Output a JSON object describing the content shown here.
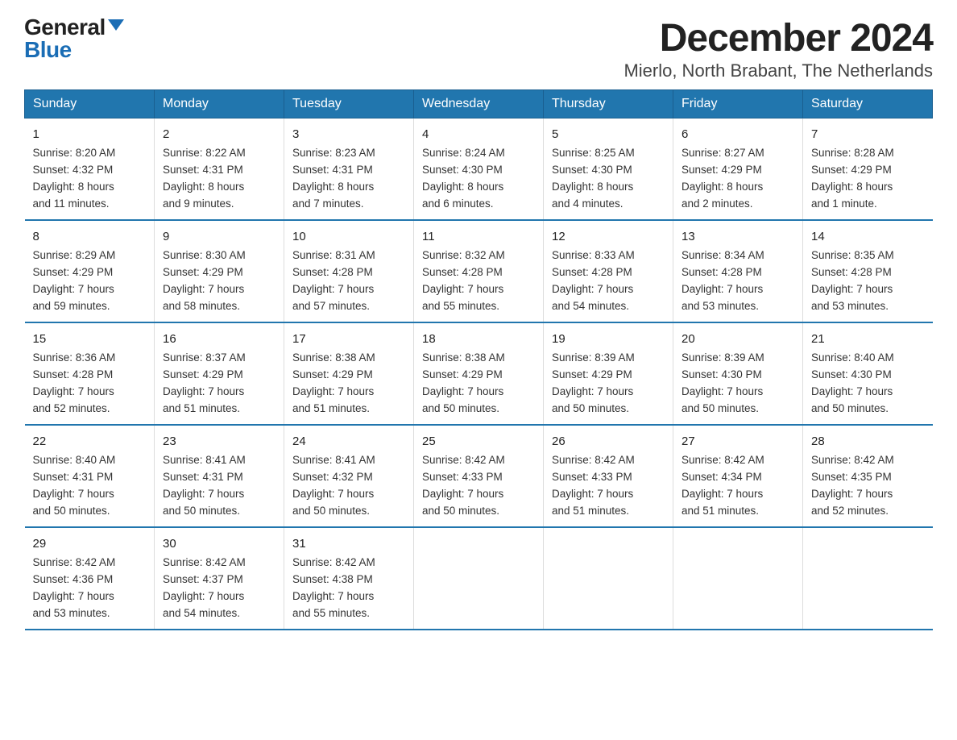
{
  "logo": {
    "general": "General",
    "blue": "Blue"
  },
  "title": "December 2024",
  "subtitle": "Mierlo, North Brabant, The Netherlands",
  "days_of_week": [
    "Sunday",
    "Monday",
    "Tuesday",
    "Wednesday",
    "Thursday",
    "Friday",
    "Saturday"
  ],
  "weeks": [
    [
      {
        "num": "1",
        "info": "Sunrise: 8:20 AM\nSunset: 4:32 PM\nDaylight: 8 hours\nand 11 minutes."
      },
      {
        "num": "2",
        "info": "Sunrise: 8:22 AM\nSunset: 4:31 PM\nDaylight: 8 hours\nand 9 minutes."
      },
      {
        "num": "3",
        "info": "Sunrise: 8:23 AM\nSunset: 4:31 PM\nDaylight: 8 hours\nand 7 minutes."
      },
      {
        "num": "4",
        "info": "Sunrise: 8:24 AM\nSunset: 4:30 PM\nDaylight: 8 hours\nand 6 minutes."
      },
      {
        "num": "5",
        "info": "Sunrise: 8:25 AM\nSunset: 4:30 PM\nDaylight: 8 hours\nand 4 minutes."
      },
      {
        "num": "6",
        "info": "Sunrise: 8:27 AM\nSunset: 4:29 PM\nDaylight: 8 hours\nand 2 minutes."
      },
      {
        "num": "7",
        "info": "Sunrise: 8:28 AM\nSunset: 4:29 PM\nDaylight: 8 hours\nand 1 minute."
      }
    ],
    [
      {
        "num": "8",
        "info": "Sunrise: 8:29 AM\nSunset: 4:29 PM\nDaylight: 7 hours\nand 59 minutes."
      },
      {
        "num": "9",
        "info": "Sunrise: 8:30 AM\nSunset: 4:29 PM\nDaylight: 7 hours\nand 58 minutes."
      },
      {
        "num": "10",
        "info": "Sunrise: 8:31 AM\nSunset: 4:28 PM\nDaylight: 7 hours\nand 57 minutes."
      },
      {
        "num": "11",
        "info": "Sunrise: 8:32 AM\nSunset: 4:28 PM\nDaylight: 7 hours\nand 55 minutes."
      },
      {
        "num": "12",
        "info": "Sunrise: 8:33 AM\nSunset: 4:28 PM\nDaylight: 7 hours\nand 54 minutes."
      },
      {
        "num": "13",
        "info": "Sunrise: 8:34 AM\nSunset: 4:28 PM\nDaylight: 7 hours\nand 53 minutes."
      },
      {
        "num": "14",
        "info": "Sunrise: 8:35 AM\nSunset: 4:28 PM\nDaylight: 7 hours\nand 53 minutes."
      }
    ],
    [
      {
        "num": "15",
        "info": "Sunrise: 8:36 AM\nSunset: 4:28 PM\nDaylight: 7 hours\nand 52 minutes."
      },
      {
        "num": "16",
        "info": "Sunrise: 8:37 AM\nSunset: 4:29 PM\nDaylight: 7 hours\nand 51 minutes."
      },
      {
        "num": "17",
        "info": "Sunrise: 8:38 AM\nSunset: 4:29 PM\nDaylight: 7 hours\nand 51 minutes."
      },
      {
        "num": "18",
        "info": "Sunrise: 8:38 AM\nSunset: 4:29 PM\nDaylight: 7 hours\nand 50 minutes."
      },
      {
        "num": "19",
        "info": "Sunrise: 8:39 AM\nSunset: 4:29 PM\nDaylight: 7 hours\nand 50 minutes."
      },
      {
        "num": "20",
        "info": "Sunrise: 8:39 AM\nSunset: 4:30 PM\nDaylight: 7 hours\nand 50 minutes."
      },
      {
        "num": "21",
        "info": "Sunrise: 8:40 AM\nSunset: 4:30 PM\nDaylight: 7 hours\nand 50 minutes."
      }
    ],
    [
      {
        "num": "22",
        "info": "Sunrise: 8:40 AM\nSunset: 4:31 PM\nDaylight: 7 hours\nand 50 minutes."
      },
      {
        "num": "23",
        "info": "Sunrise: 8:41 AM\nSunset: 4:31 PM\nDaylight: 7 hours\nand 50 minutes."
      },
      {
        "num": "24",
        "info": "Sunrise: 8:41 AM\nSunset: 4:32 PM\nDaylight: 7 hours\nand 50 minutes."
      },
      {
        "num": "25",
        "info": "Sunrise: 8:42 AM\nSunset: 4:33 PM\nDaylight: 7 hours\nand 50 minutes."
      },
      {
        "num": "26",
        "info": "Sunrise: 8:42 AM\nSunset: 4:33 PM\nDaylight: 7 hours\nand 51 minutes."
      },
      {
        "num": "27",
        "info": "Sunrise: 8:42 AM\nSunset: 4:34 PM\nDaylight: 7 hours\nand 51 minutes."
      },
      {
        "num": "28",
        "info": "Sunrise: 8:42 AM\nSunset: 4:35 PM\nDaylight: 7 hours\nand 52 minutes."
      }
    ],
    [
      {
        "num": "29",
        "info": "Sunrise: 8:42 AM\nSunset: 4:36 PM\nDaylight: 7 hours\nand 53 minutes."
      },
      {
        "num": "30",
        "info": "Sunrise: 8:42 AM\nSunset: 4:37 PM\nDaylight: 7 hours\nand 54 minutes."
      },
      {
        "num": "31",
        "info": "Sunrise: 8:42 AM\nSunset: 4:38 PM\nDaylight: 7 hours\nand 55 minutes."
      },
      null,
      null,
      null,
      null
    ]
  ]
}
